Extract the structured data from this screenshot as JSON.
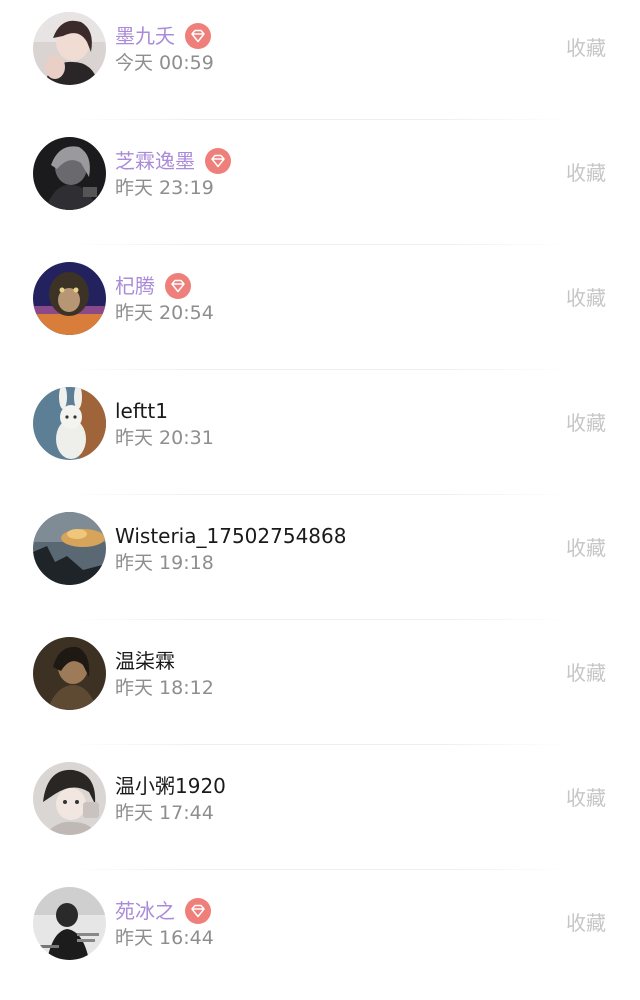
{
  "items": [
    {
      "name": "墨九夭",
      "time": "今天 00:59",
      "vip": true,
      "action": "收藏"
    },
    {
      "name": "芝霖逸墨",
      "time": "昨天 23:19",
      "vip": true,
      "action": "收藏"
    },
    {
      "name": "杞腾",
      "time": "昨天 20:54",
      "vip": true,
      "action": "收藏"
    },
    {
      "name": "leftt1",
      "time": "昨天 20:31",
      "vip": false,
      "action": "收藏"
    },
    {
      "name": "Wisteria_17502754868",
      "time": "昨天 19:18",
      "vip": false,
      "action": "收藏"
    },
    {
      "name": "温柒霖",
      "time": "昨天 18:12",
      "vip": false,
      "action": "收藏"
    },
    {
      "name": "温小粥1920",
      "time": "昨天 17:44",
      "vip": false,
      "action": "收藏"
    },
    {
      "name": "苑冰之",
      "time": "昨天 16:44",
      "vip": true,
      "action": "收藏"
    }
  ],
  "colors": {
    "vip_name": "#a98bd9",
    "normal_name": "#1a1a1a",
    "time_text": "#8e8e8e",
    "collect_text": "#c6c6c6",
    "vip_badge": "#ef7f7a"
  },
  "icons": {
    "avatar": "user-avatar-photo",
    "vip_badge": "diamond-icon"
  }
}
